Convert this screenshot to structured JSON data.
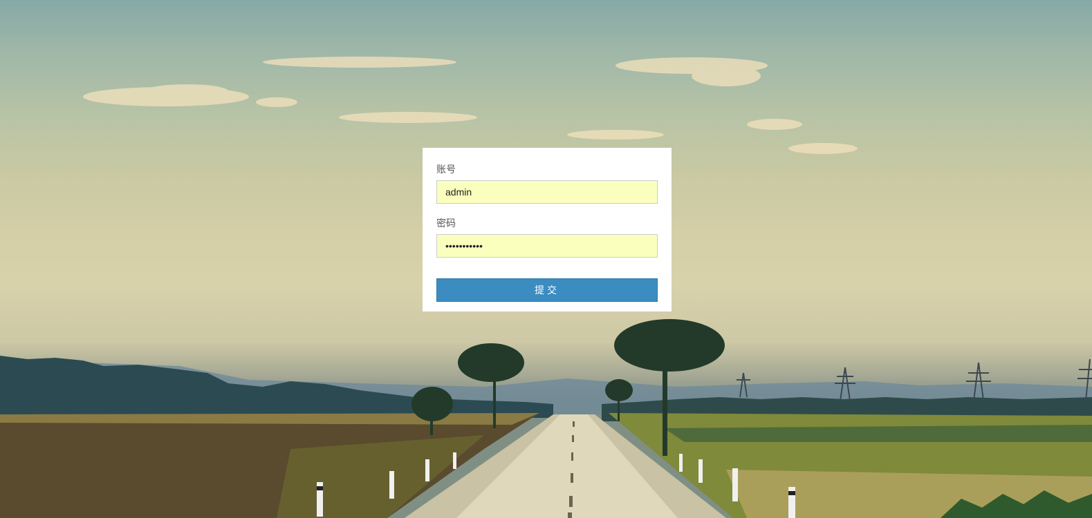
{
  "login": {
    "account_label": "账号",
    "account_value": "admin",
    "password_label": "密码",
    "password_value": "12345678901",
    "submit_label": "提交"
  },
  "colors": {
    "card_bg": "#ffffff",
    "input_bg": "#faffbd",
    "button_bg": "#3a8cc1",
    "button_text": "#ffffff"
  }
}
